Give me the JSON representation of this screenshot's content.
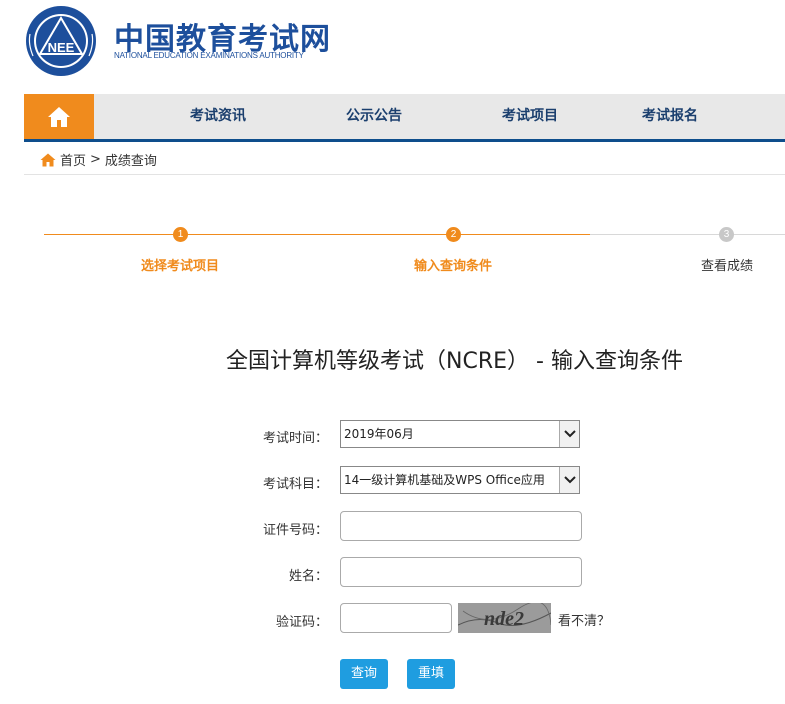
{
  "brand": {
    "logo_text": "NEE",
    "name_cn": "中国教育考试网",
    "name_en": "NATIONAL EDUCATION EXAMINATIONS AUTHORITY"
  },
  "nav": {
    "items": [
      "考试资讯",
      "公示公告",
      "考试项目",
      "考试报名"
    ]
  },
  "breadcrumb": {
    "home": "首页",
    "separator": ">",
    "current": "成绩查询"
  },
  "steps": [
    {
      "num": "1",
      "label": "选择考试项目",
      "state": "done"
    },
    {
      "num": "2",
      "label": "输入查询条件",
      "state": "active"
    },
    {
      "num": "3",
      "label": "查看成绩",
      "state": "pending"
    }
  ],
  "page_title": "全国计算机等级考试（NCRE） - 输入查询条件",
  "form": {
    "exam_time": {
      "label": "考试时间：",
      "value": "2019年06月"
    },
    "subject": {
      "label": "考试科目：",
      "value": "14一级计算机基础及WPS Office应用"
    },
    "id_number": {
      "label": "证件号码：",
      "value": ""
    },
    "name": {
      "label": "姓名：",
      "value": ""
    },
    "captcha": {
      "label": "验证码：",
      "value": "",
      "image_text": "nde2",
      "refresh_text": "看不清？"
    }
  },
  "buttons": {
    "query": "查询",
    "reset": "重填"
  },
  "colors": {
    "brand_blue": "#1d4f9c",
    "nav_orange": "#f08b1d",
    "nav_bar_border": "#0e4e8c",
    "step_orange": "#f08b1d",
    "step_grey": "#c8c8c8",
    "button_blue": "#1f9de0"
  }
}
